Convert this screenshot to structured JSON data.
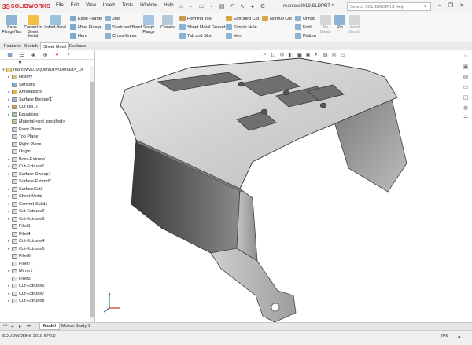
{
  "app": {
    "logo_prefix": "3S",
    "logo_text": "SOLIDWORKS",
    "doc_title": "rearcow2019.SLDPRT *",
    "search_placeholder": "Search SOLIDWORKS Help",
    "menu": [
      "File",
      "Edit",
      "View",
      "Insert",
      "Tools",
      "Window",
      "Help"
    ]
  },
  "ribbon": {
    "base_flange": "Base Flange/Tab",
    "convert": "Convert to Sheet Metal",
    "lofted_bend": "Lofted-Bend",
    "edge_flange": "Edge Flange",
    "miter_flange": "Miter Flange",
    "hem": "Hem",
    "jog": "Jog",
    "sketched_bend": "Sketched Bend",
    "cross_break": "Cross-Break",
    "swept_flange": "Swept Flange",
    "corners": "Corners",
    "forming_tool": "Forming Tool",
    "gusset": "Sheet Metal Gusset",
    "tab_slot": "Tab and Slot",
    "extruded_cut": "Extruded Cut",
    "simple_hole": "Simple Hole",
    "vent": "Vent",
    "normal_cut": "Normal Cut",
    "unfold": "Unfold",
    "fold": "Fold",
    "flatten": "Flatten",
    "no_bends": "No Bends",
    "rip": "Rip",
    "insert_bends": "Insert Bends"
  },
  "cm_tabs": [
    "Features",
    "Sketch",
    "Sheet Metal",
    "Evaluate"
  ],
  "tree_root": "rearcow2019 (Default<<Default>_Di",
  "tree": [
    {
      "label": "History",
      "arrow": "▸"
    },
    {
      "label": "Sensors",
      "arrow": ""
    },
    {
      "label": "Annotations",
      "arrow": "▸"
    },
    {
      "label": "Surface Bodies(1)",
      "arrow": "▸"
    },
    {
      "label": "Cut list(1)",
      "arrow": "▸"
    },
    {
      "label": "Equations",
      "arrow": "▸"
    },
    {
      "label": "Material <not specified>",
      "arrow": ""
    },
    {
      "label": "Front Plane",
      "arrow": ""
    },
    {
      "label": "Top Plane",
      "arrow": ""
    },
    {
      "label": "Right Plane",
      "arrow": ""
    },
    {
      "label": "Origin",
      "arrow": ""
    },
    {
      "label": "Boss-Extrude1",
      "arrow": "▸"
    },
    {
      "label": "Cut-Extrude1",
      "arrow": "▸"
    },
    {
      "label": "Surface-Sweep1",
      "arrow": "▸"
    },
    {
      "label": "Surface-Extend2",
      "arrow": ""
    },
    {
      "label": "SurfaceCut3",
      "arrow": "▸"
    },
    {
      "label": "Sheet-Metal",
      "arrow": "▸"
    },
    {
      "label": "Convert-Solid1",
      "arrow": "▸"
    },
    {
      "label": "Cut-Extrude2",
      "arrow": "▸"
    },
    {
      "label": "Cut-Extrude3",
      "arrow": "▸"
    },
    {
      "label": "Fillet1",
      "arrow": ""
    },
    {
      "label": "Fillet4",
      "arrow": ""
    },
    {
      "label": "Cut-Extrude4",
      "arrow": "▸"
    },
    {
      "label": "Cut-Extrude5",
      "arrow": "▸"
    },
    {
      "label": "Fillet6",
      "arrow": ""
    },
    {
      "label": "Fillet7",
      "arrow": ""
    },
    {
      "label": "Mirror1",
      "arrow": "▸"
    },
    {
      "label": "Fillet3",
      "arrow": ""
    },
    {
      "label": "Cut-Extrude6",
      "arrow": "▸"
    },
    {
      "label": "Cut-Extrude7",
      "arrow": "▸"
    },
    {
      "label": "Cut-Extrude8",
      "arrow": "▸"
    }
  ],
  "bottom_tabs": [
    "Model",
    "Motion Study 1"
  ],
  "status": {
    "version": "SOLIDWORKS 2019 SP2.0",
    "units": "IPS"
  }
}
